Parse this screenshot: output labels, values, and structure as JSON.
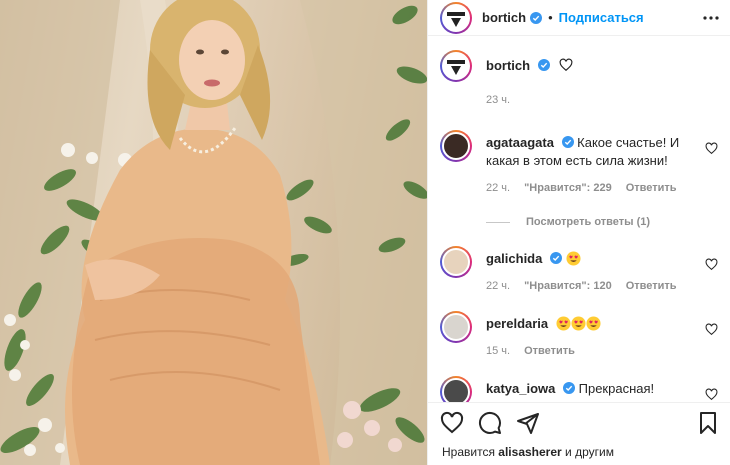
{
  "header": {
    "username": "bortich",
    "separator": "•",
    "follow_label": "Подписаться"
  },
  "caption": {
    "username": "bortich",
    "time": "23 ч."
  },
  "comments": [
    {
      "username": "agataagata",
      "verified": true,
      "text": "Какое счастье! И какая в этом есть сила жизни!",
      "time": "22 ч.",
      "likes": "\"Нравится\": 229",
      "reply": "Ответить",
      "view_replies": "Посмотреть ответы (1)"
    },
    {
      "username": "galichida",
      "verified": true,
      "text": "",
      "emoji_count": 1,
      "time": "22 ч.",
      "likes": "\"Нравится\": 120",
      "reply": "Ответить"
    },
    {
      "username": "pereldaria",
      "verified": false,
      "text": "",
      "emoji_count": 3,
      "time": "15 ч.",
      "reply": "Ответить"
    },
    {
      "username": "katya_iowa",
      "verified": true,
      "text": "Прекрасная!"
    }
  ],
  "footer": {
    "likes_prefix": "Нравится",
    "likes_user": "alisasherer",
    "likes_suffix": "и другим"
  },
  "colors": {
    "accent": "#0095f6",
    "verified": "#3897f0",
    "muted": "#8e8e8e"
  },
  "icons": [
    "more-icon",
    "heart-icon",
    "comment-icon",
    "share-icon",
    "bookmark-icon",
    "verified-icon"
  ]
}
